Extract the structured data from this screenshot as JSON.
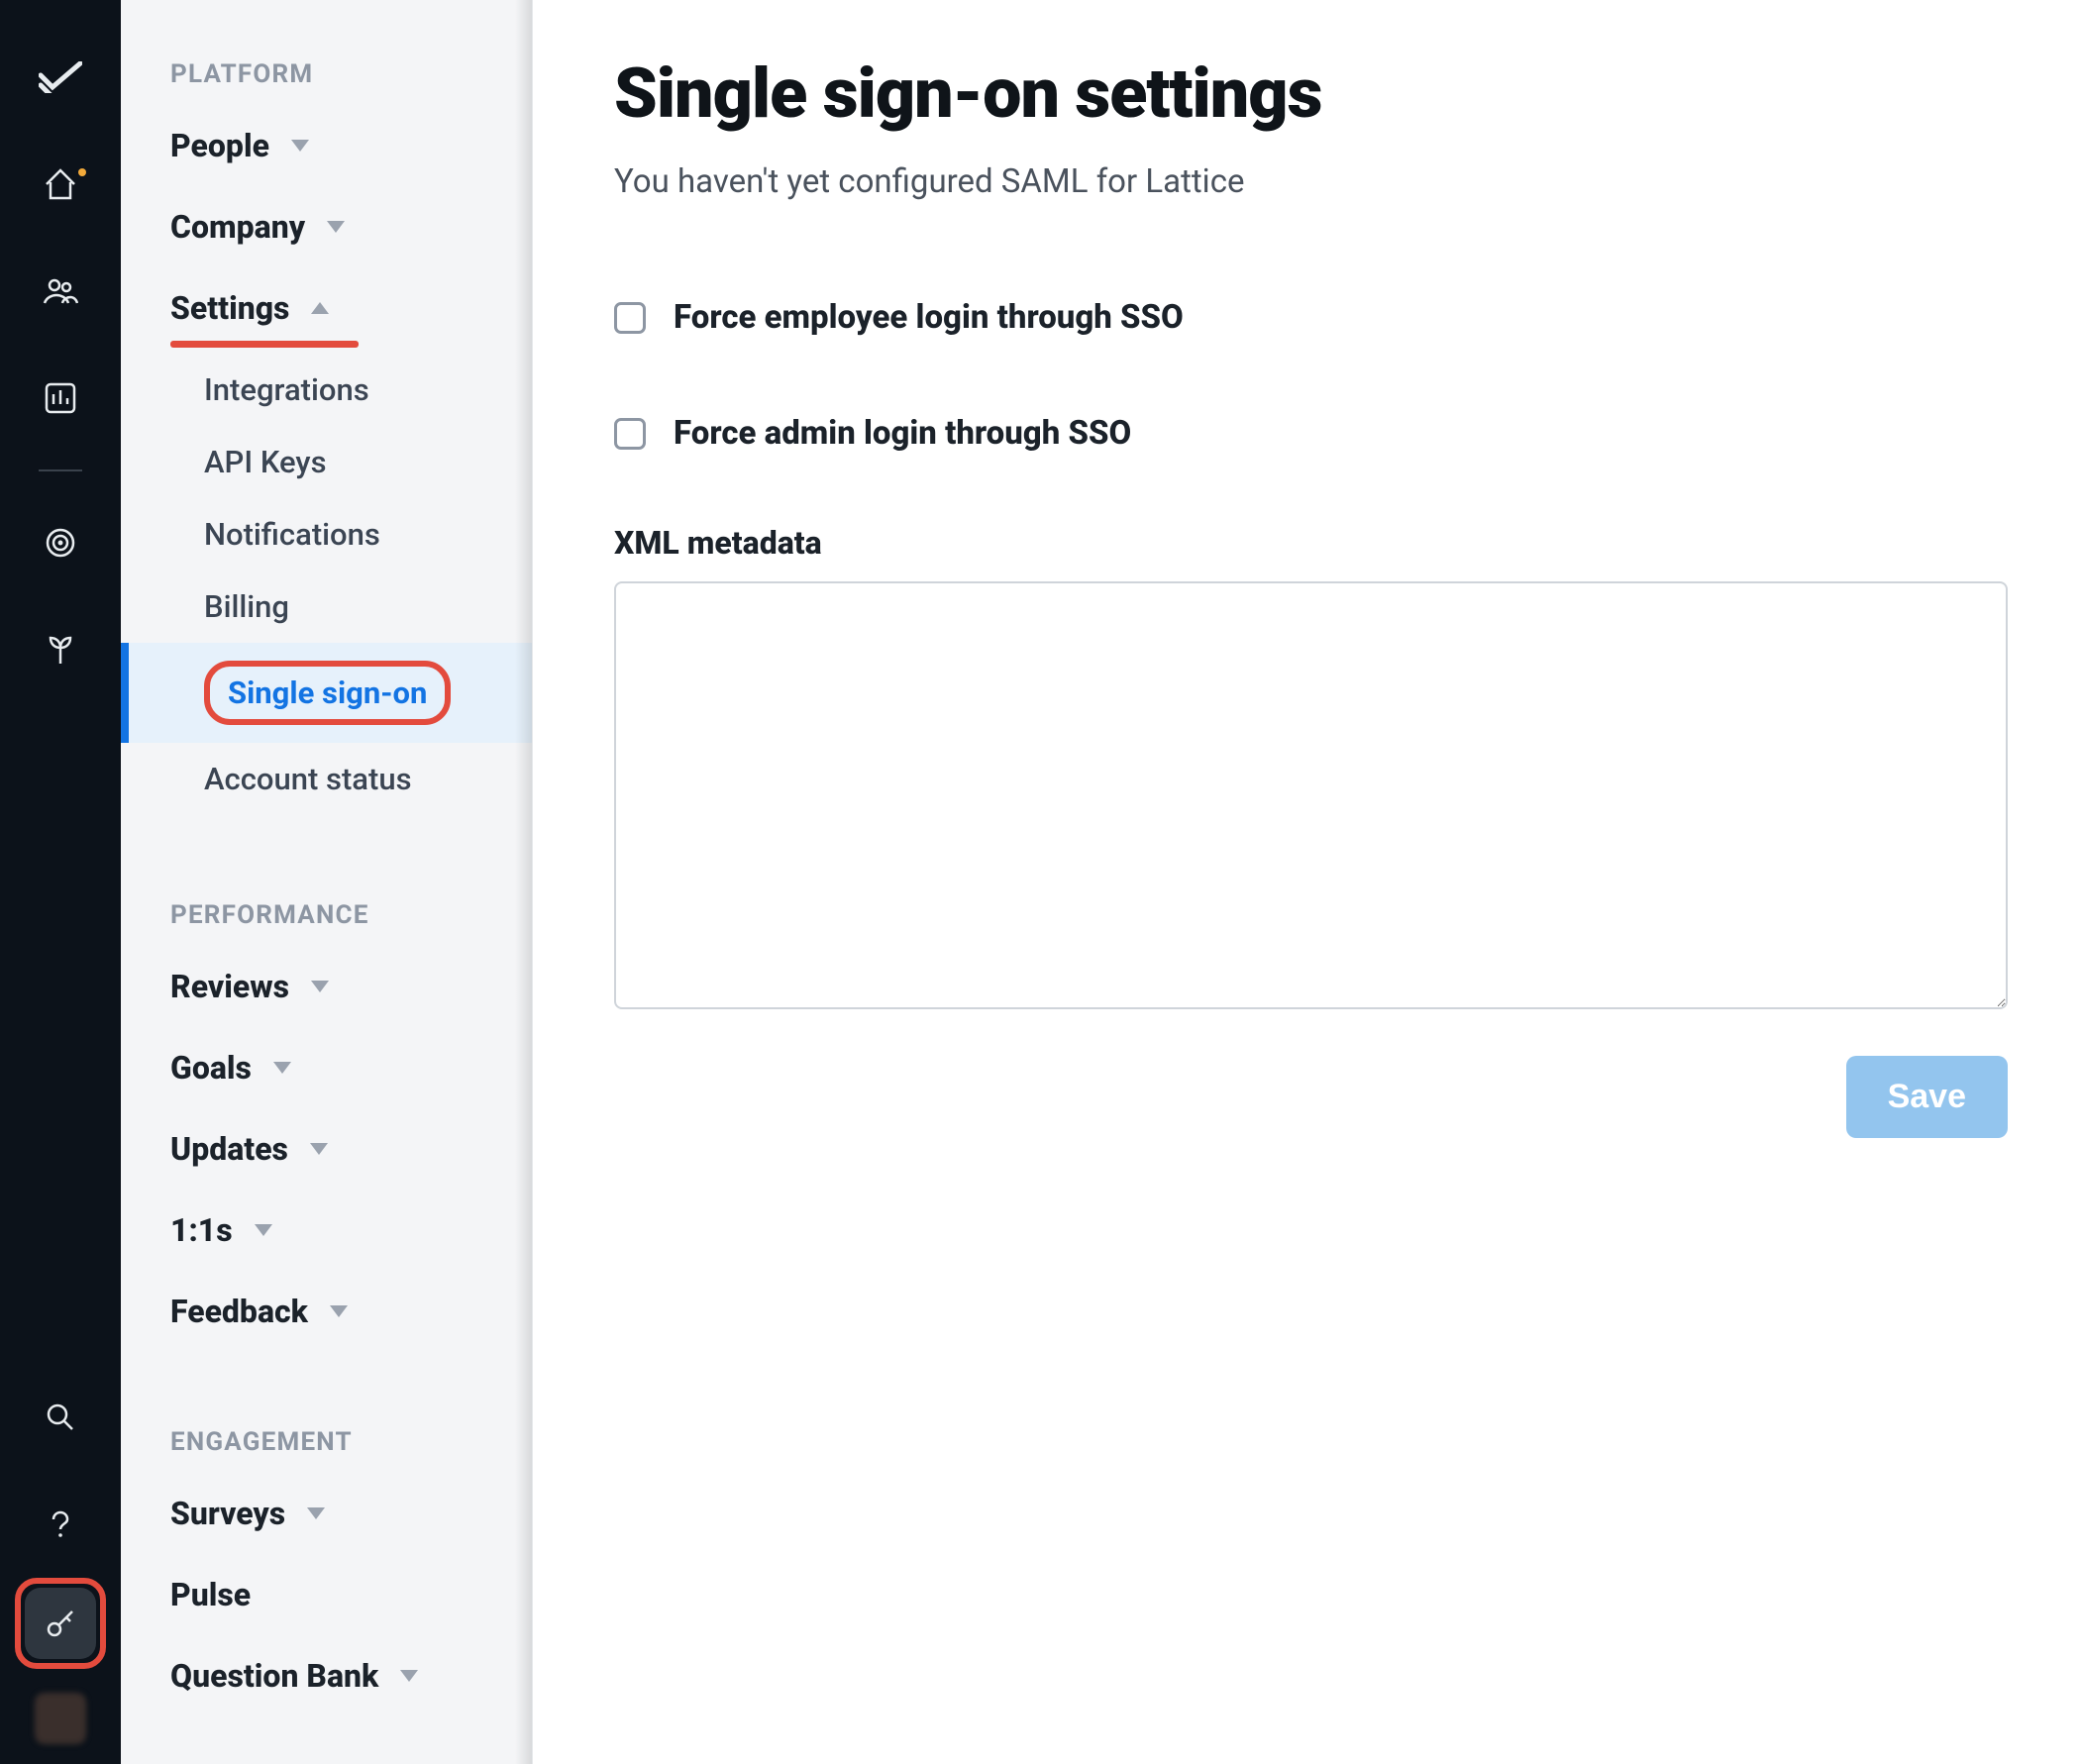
{
  "rail": {
    "logo": "lattice-logo",
    "top_icons": [
      {
        "name": "home-icon",
        "dot": true
      },
      {
        "name": "people-icon",
        "dot": false
      },
      {
        "name": "chart-icon",
        "dot": false
      }
    ],
    "mid_icons": [
      {
        "name": "target-icon"
      },
      {
        "name": "grow-icon"
      }
    ],
    "bottom_icons": [
      {
        "name": "search-icon"
      },
      {
        "name": "help-icon"
      }
    ],
    "key_icon": "key-icon",
    "avatar": "user-avatar"
  },
  "sidebar": {
    "sections": {
      "platform": "PLATFORM",
      "performance": "PERFORMANCE",
      "engagement": "ENGAGEMENT"
    },
    "platform": {
      "people": "People",
      "company": "Company",
      "settings": "Settings",
      "settings_children": {
        "integrations": "Integrations",
        "api_keys": "API Keys",
        "notifications": "Notifications",
        "billing": "Billing",
        "sso": "Single sign-on",
        "account_status": "Account status"
      }
    },
    "performance": {
      "reviews": "Reviews",
      "goals": "Goals",
      "updates": "Updates",
      "one_on_ones": "1:1s",
      "feedback": "Feedback"
    },
    "engagement": {
      "surveys": "Surveys",
      "pulse": "Pulse",
      "question_bank": "Question Bank"
    }
  },
  "main": {
    "title": "Single sign-on settings",
    "subtitle": "You haven't yet configured SAML for Lattice",
    "force_employee_label": "Force employee login through SSO",
    "force_admin_label": "Force admin login through SSO",
    "xml_label": "XML metadata",
    "xml_value": "",
    "save_label": "Save"
  }
}
